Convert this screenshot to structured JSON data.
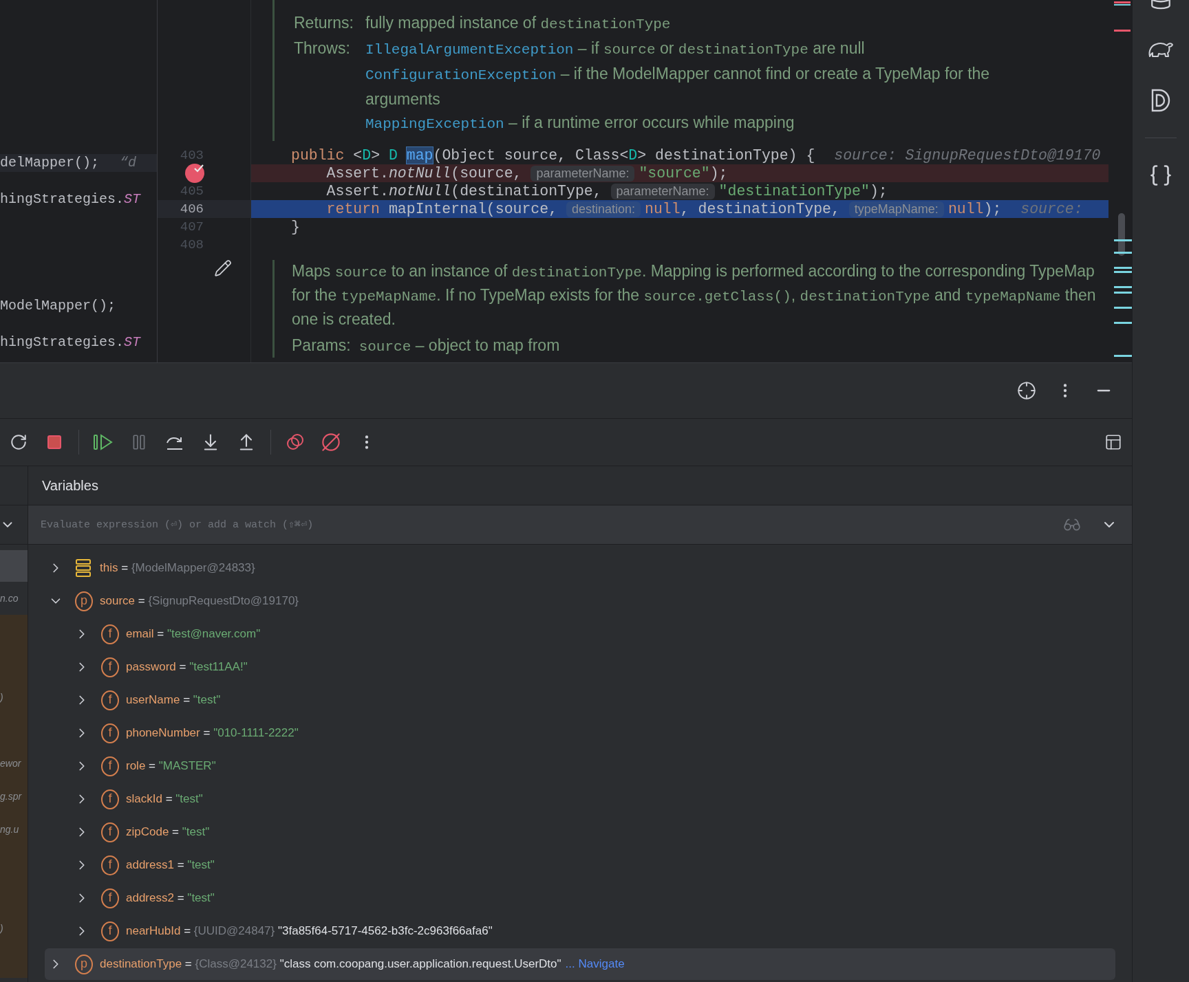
{
  "left_editor": {
    "lines": [
      {
        "highlighted": true,
        "segments": [
          {
            "kind": "plain",
            "text": "delMapper();"
          },
          {
            "kind": "hint",
            "text": "“d"
          }
        ]
      },
      {
        "highlighted": false,
        "segments": [
          {
            "kind": "plain",
            "text": "hingStrategies."
          },
          {
            "kind": "constant",
            "text": "ST"
          }
        ]
      },
      {
        "highlighted": false,
        "segments": [
          {
            "kind": "plain",
            "text": "ModelMapper();"
          }
        ]
      },
      {
        "highlighted": false,
        "segments": [
          {
            "kind": "plain",
            "text": "hingStrategies."
          },
          {
            "kind": "constant",
            "text": "ST"
          }
        ]
      }
    ]
  },
  "doc_top": {
    "sections": [
      {
        "label": "Returns:",
        "entries": [
          {
            "parts": [
              {
                "kind": "text",
                "text": "fully mapped instance of "
              },
              {
                "kind": "code",
                "text": "destinationType"
              }
            ]
          }
        ]
      },
      {
        "label": "Throws:",
        "entries": [
          {
            "parts": [
              {
                "kind": "link",
                "text": "IllegalArgumentException"
              },
              {
                "kind": "text",
                "text": " – if "
              },
              {
                "kind": "code",
                "text": "source"
              },
              {
                "kind": "text",
                "text": " or "
              },
              {
                "kind": "code",
                "text": "destinationType"
              },
              {
                "kind": "text",
                "text": " are null"
              }
            ]
          },
          {
            "parts": [
              {
                "kind": "link",
                "text": "ConfigurationException"
              },
              {
                "kind": "text",
                "text": " – if the ModelMapper cannot find or create a TypeMap for the arguments"
              }
            ]
          },
          {
            "parts": [
              {
                "kind": "link",
                "text": "MappingException"
              },
              {
                "kind": "text",
                "text": " – if a runtime error occurs while mapping"
              }
            ]
          }
        ]
      }
    ]
  },
  "code": {
    "lines": [
      {
        "number": "403",
        "breakpoint": false,
        "current": false,
        "tokens": [
          {
            "kind": "keyword",
            "text": "public "
          },
          {
            "kind": "plain",
            "text": "<"
          },
          {
            "kind": "typeparam",
            "text": "D"
          },
          {
            "kind": "plain",
            "text": "> "
          },
          {
            "kind": "typeparam",
            "text": "D "
          },
          {
            "kind": "function",
            "text": "map"
          },
          {
            "kind": "plain",
            "text": "(Object source, Class<"
          },
          {
            "kind": "typeparam",
            "text": "D"
          },
          {
            "kind": "plain",
            "text": "> destinationType) {"
          },
          {
            "kind": "inline",
            "text": "source: SignupRequestDto@19170"
          }
        ]
      },
      {
        "breakpoint": true,
        "current": false,
        "tokens": [
          {
            "kind": "plain",
            "text": "    Assert."
          },
          {
            "kind": "italic",
            "text": "notNull"
          },
          {
            "kind": "plain",
            "text": "(source, "
          },
          {
            "kind": "hint",
            "text": "parameterName:"
          },
          {
            "kind": "string",
            "text": "\"source\""
          },
          {
            "kind": "plain",
            "text": ");"
          }
        ]
      },
      {
        "number": "405",
        "breakpoint": false,
        "current": false,
        "tokens": [
          {
            "kind": "plain",
            "text": "    Assert."
          },
          {
            "kind": "italic",
            "text": "notNull"
          },
          {
            "kind": "plain",
            "text": "(destinationType, "
          },
          {
            "kind": "hint",
            "text": "parameterName:"
          },
          {
            "kind": "string",
            "text": "\"destinationType\""
          },
          {
            "kind": "plain",
            "text": ");"
          }
        ]
      },
      {
        "number": "406",
        "breakpoint": false,
        "current": true,
        "tokens": [
          {
            "kind": "keyword",
            "text": "    return "
          },
          {
            "kind": "plain",
            "text": "mapInternal(source, "
          },
          {
            "kind": "hint",
            "text": "destination:"
          },
          {
            "kind": "keyword",
            "text": "null"
          },
          {
            "kind": "plain",
            "text": ", destinationType, "
          },
          {
            "kind": "hint",
            "text": "typeMapName:"
          },
          {
            "kind": "keyword",
            "text": "null"
          },
          {
            "kind": "plain",
            "text": ");"
          },
          {
            "kind": "inline",
            "text": "source:"
          }
        ]
      },
      {
        "number": "407",
        "breakpoint": false,
        "current": false,
        "tokens": [
          {
            "kind": "plain",
            "text": "}"
          }
        ]
      },
      {
        "number": "408",
        "breakpoint": false,
        "current": false
      }
    ]
  },
  "doc_bottom": {
    "parts": [
      {
        "kind": "text",
        "text": "Maps "
      },
      {
        "kind": "code",
        "text": "source"
      },
      {
        "kind": "text",
        "text": " to an instance of "
      },
      {
        "kind": "code",
        "text": "destinationType"
      },
      {
        "kind": "text",
        "text": ". Mapping is performed according to the corresponding TypeMap for the "
      },
      {
        "kind": "code",
        "text": "typeMapName"
      },
      {
        "kind": "text",
        "text": ". If no TypeMap exists for the "
      },
      {
        "kind": "code",
        "text": "source.getClass()"
      },
      {
        "kind": "text",
        "text": ", "
      },
      {
        "kind": "code",
        "text": "destinationType"
      },
      {
        "kind": "text",
        "text": " and "
      },
      {
        "kind": "code",
        "text": "typeMapName"
      },
      {
        "kind": "text",
        "text": " then one is created."
      }
    ],
    "params_label": "Params:",
    "params_parts": [
      {
        "kind": "code",
        "text": "source"
      },
      {
        "kind": "text",
        "text": " – object to map from"
      }
    ]
  },
  "debugger": {
    "tab": "Variables",
    "eval_placeholder": "Evaluate expression (⏎) or add a watch (⇧⌘⏎)",
    "frames": [
      {
        "selected": true,
        "library": false
      },
      {
        "text": "n.co",
        "selected": false,
        "library": false
      },
      {
        "selected": false,
        "library": true
      },
      {
        "selected": false,
        "library": true
      },
      {
        "text": ")",
        "selected": false,
        "library": true
      },
      {
        "selected": false,
        "library": true
      },
      {
        "text": "ewor",
        "selected": false,
        "library": true
      },
      {
        "text": "g.spr",
        "selected": false,
        "library": true
      },
      {
        "text": "ng.u",
        "selected": false,
        "library": true
      },
      {
        "selected": false,
        "library": true
      },
      {
        "selected": false,
        "library": true
      },
      {
        "text": ")",
        "selected": false,
        "library": true
      },
      {
        "selected": false,
        "library": true
      }
    ],
    "nodes": [
      {
        "name": "this",
        "assign": "=",
        "type_label": "{ModelMapper@24833}",
        "expanded": false,
        "selected": false
      },
      {
        "badge": "p",
        "name": "source",
        "assign": "=",
        "type_label": "{SignupRequestDto@19170}",
        "expanded": true,
        "selected": false,
        "children": [
          {
            "badge": "f",
            "name": "email",
            "assign": "=",
            "value": "\"test@naver.com\"",
            "expanded": false,
            "selected": false
          },
          {
            "badge": "f",
            "name": "password",
            "assign": "=",
            "value": "\"test11AA!\"",
            "expanded": false,
            "selected": false
          },
          {
            "badge": "f",
            "name": "userName",
            "assign": "=",
            "value": "\"test\"",
            "expanded": false,
            "selected": false
          },
          {
            "badge": "f",
            "name": "phoneNumber",
            "assign": "=",
            "value": "\"010-1111-2222\"",
            "expanded": false,
            "selected": false
          },
          {
            "badge": "f",
            "name": "role",
            "assign": "=",
            "value": "\"MASTER\"",
            "expanded": false,
            "selected": false
          },
          {
            "badge": "f",
            "name": "slackId",
            "assign": "=",
            "value": "\"test\"",
            "expanded": false,
            "selected": false
          },
          {
            "badge": "f",
            "name": "zipCode",
            "assign": "=",
            "value": "\"test\"",
            "expanded": false,
            "selected": false
          },
          {
            "badge": "f",
            "name": "address1",
            "assign": "=",
            "value": "\"test\"",
            "expanded": false,
            "selected": false
          },
          {
            "badge": "f",
            "name": "address2",
            "assign": "=",
            "value": "\"test\"",
            "expanded": false,
            "selected": false
          },
          {
            "badge": "f",
            "name": "nearHubId",
            "assign": "=",
            "type_label": "{UUID@24847}",
            "value": "\"3fa85f64-5717-4562-b3fc-2c963f66afa6\"",
            "expanded": false,
            "selected": false
          }
        ]
      },
      {
        "badge": "p",
        "name": "destinationType",
        "assign": "=",
        "type_label": "{Class@24132}",
        "value": "\"class com.coopang.user.application.request.UserDto\"",
        "link": "... Navigate",
        "expanded": false,
        "selected": true
      }
    ]
  }
}
